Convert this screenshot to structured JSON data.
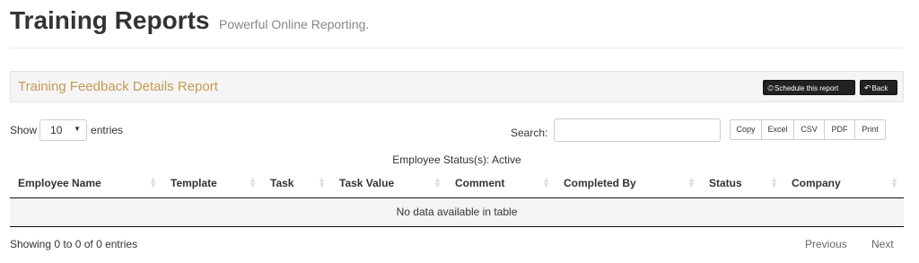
{
  "header": {
    "title": "Training Reports",
    "subtitle": "Powerful Online Reporting."
  },
  "panel": {
    "title": "Training Feedback Details Report",
    "schedule_icon": "clock-icon",
    "schedule_label": "Schedule this report",
    "back_icon": "reply-icon",
    "back_label": "Back",
    "accent_color": "#c79a54"
  },
  "length": {
    "prefix": "Show",
    "selected": "10",
    "suffix": "entries"
  },
  "search": {
    "label": "Search:",
    "value": ""
  },
  "export_buttons": [
    "Copy",
    "Excel",
    "CSV",
    "PDF",
    "Print"
  ],
  "table": {
    "caption": "Employee Status(s): Active",
    "columns": [
      "Employee Name",
      "Template",
      "Task",
      "Task Value",
      "Comment",
      "Completed By",
      "Status",
      "Company"
    ],
    "empty_message": "No data available in table"
  },
  "footer": {
    "info": "Showing 0 to 0 of 0 entries",
    "previous": "Previous",
    "next": "Next"
  }
}
